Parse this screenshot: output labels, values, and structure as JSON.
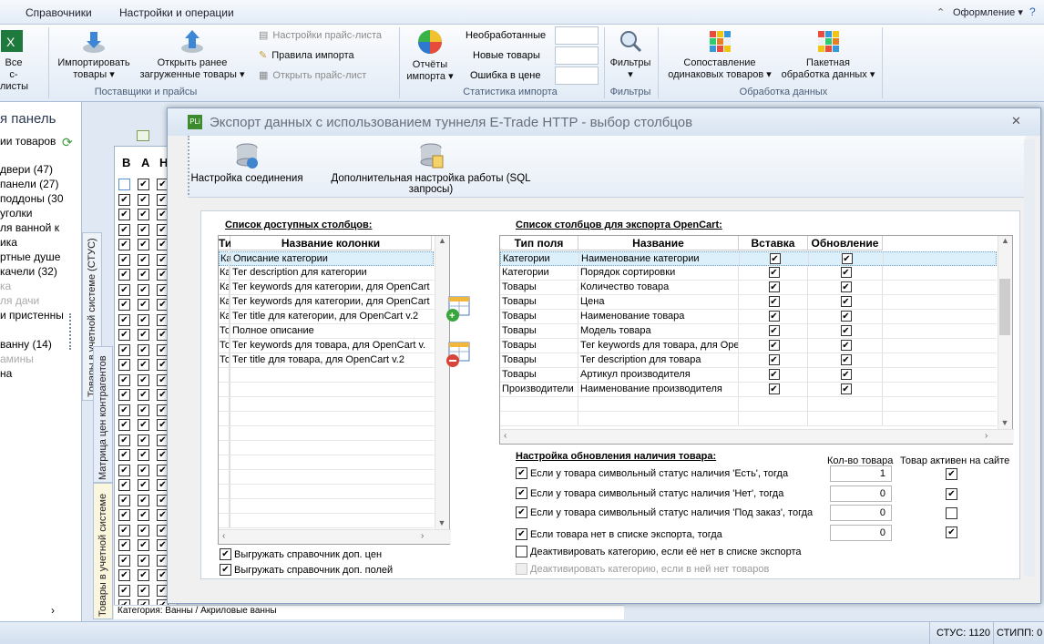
{
  "menubar": {
    "tabs": [
      "Справочники",
      "Настройки и операции"
    ],
    "theme_label": "Оформление"
  },
  "ribbon": {
    "all_pricelists": {
      "line1": "Все",
      "line2": "с-листы"
    },
    "import_products": {
      "line1": "Импортировать",
      "line2": "товары"
    },
    "open_loaded": {
      "line1": "Открыть ранее",
      "line2": "загруженные товары"
    },
    "small_buttons": [
      "Настройки прайс-листа",
      "Правила импорта",
      "Открыть прайс-лист"
    ],
    "group_suppliers": "Поставщики и прайсы",
    "reports": {
      "line1": "Отчёты",
      "line2": "импорта"
    },
    "stats": [
      "Необработанные",
      "Новые товары",
      "Ошибка в цене"
    ],
    "group_stats": "Статистика импорта",
    "filters": "Фильтры",
    "group_filters": "Фильтры",
    "match": {
      "line1": "Сопоставление",
      "line2": "одинаковых товаров"
    },
    "batch": {
      "line1": "Пакетная",
      "line2": "обработка данных"
    },
    "group_processing": "Обработка данных"
  },
  "left_panel": {
    "title": "я панель",
    "items": [
      "ии товаров",
      "двери (47)",
      "панели (27)",
      "поддоны (30",
      "уголки",
      "ля ванной к",
      "ика",
      "ртные душе",
      "качели (32)",
      "ка",
      "ля дачи",
      "и пристенны",
      "ванну (14)",
      "амины",
      "на"
    ]
  },
  "vertical_tabs": {
    "tab1": "Товары в учетной системе (СТУС)",
    "tab2": "Матрица цен контрагентов",
    "tab3": "Товары в учетной системе"
  },
  "back_grid": {
    "headers": [
      "В",
      "А",
      "Н"
    ],
    "footer": "Категория: Ванны / Акриловые ванны"
  },
  "dialog": {
    "title": "Экспорт данных с использованием туннеля E-Trade HTTP - выбор столбцов",
    "toolbar": {
      "connection": "Настройка соединения",
      "sql": "Дополнительная настройка работы (SQL запросы)"
    },
    "available": {
      "title": "Список доступных столбцов:",
      "headers": [
        "Ти",
        "Название колонки"
      ],
      "rows": [
        [
          "Ка",
          "Описание категории"
        ],
        [
          "Ка",
          "Тег description для категории"
        ],
        [
          "Ка",
          "Тег keywords для категории, для OpenCart"
        ],
        [
          "Ка",
          "Тег keywords для категории, для OpenCart"
        ],
        [
          "Ка",
          "Тег title для категории, для OpenCart v.2"
        ],
        [
          "То",
          "Полное описание"
        ],
        [
          "То",
          "Тег keywords для товара, для OpenCart v."
        ],
        [
          "То",
          "Тег title для товара, для OpenCart v.2"
        ]
      ]
    },
    "export": {
      "title": "Список столбцов для экспорта OpenCart:",
      "headers": [
        "Тип поля",
        "Название",
        "Вставка",
        "Обновление"
      ],
      "rows": [
        [
          "Категории",
          "Наименование категории"
        ],
        [
          "Категории",
          "Порядок сортировки"
        ],
        [
          "Товары",
          "Количество товара"
        ],
        [
          "Товары",
          "Цена"
        ],
        [
          "Товары",
          "Наименование товара"
        ],
        [
          "Товары",
          "Модель товара"
        ],
        [
          "Товары",
          "Тег keywords для товара, для Ope"
        ],
        [
          "Товары",
          "Тег description для товара"
        ],
        [
          "Товары",
          "Артикул производителя"
        ],
        [
          "Производители",
          "Наименование производителя"
        ]
      ]
    },
    "stock": {
      "title": "Настройка обновления наличия товара:",
      "col_qty": "Кол-во товара",
      "col_active": "Товар активен на сайте",
      "options": [
        "Если у товара символьный статус наличия 'Есть', тогда",
        "Если у товара символьный статус наличия 'Нет', тогда",
        "Если у товара символьный статус наличия 'Под заказ', тогда",
        "Если товара нет в списке экспорта, тогда",
        "Деактивировать категорию, если её нет в списке экспорта",
        "Деактивировать категорию, если в ней нет товаров"
      ],
      "quantities": [
        "1",
        "0",
        "0",
        "0"
      ]
    },
    "bottom_checks": [
      "Выгружать справочник доп. цен",
      "Выгружать справочник доп. полей"
    ]
  },
  "statusbar": {
    "left": "СТУС: 1120",
    "right": "СТИПП: 0"
  }
}
